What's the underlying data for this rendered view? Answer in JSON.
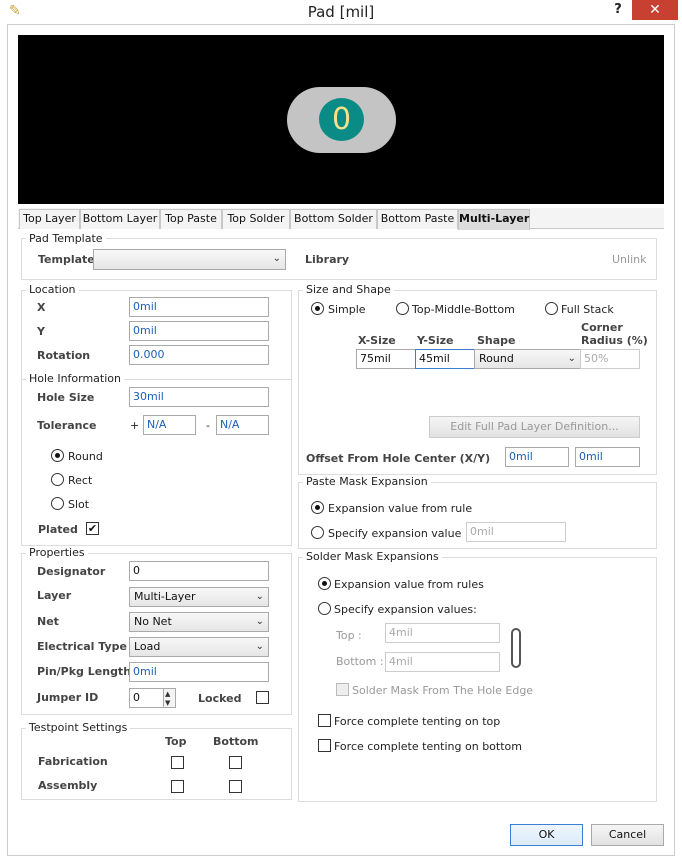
{
  "window": {
    "title": "Pad [mil]",
    "help": "?",
    "close": "✕",
    "app_icon": "pad-app-icon"
  },
  "preview": {
    "pad_number": "0",
    "pad_color": "#c4c4c4",
    "hole_color": "#0a8b86",
    "text_color": "#f3e28a"
  },
  "tabs": [
    "Top Layer",
    "Bottom Layer",
    "Top Paste",
    "Top Solder",
    "Bottom Solder",
    "Bottom Paste",
    "Multi-Layer"
  ],
  "active_tab": "Multi-Layer",
  "pad_template": {
    "title": "Pad Template",
    "template_label": "Template",
    "template_value": "",
    "library_label": "Library",
    "unlink_label": "Unlink"
  },
  "location": {
    "title": "Location",
    "x_label": "X",
    "x_value": "0mil",
    "y_label": "Y",
    "y_value": "0mil",
    "rotation_label": "Rotation",
    "rotation_value": "0.000"
  },
  "hole": {
    "title": "Hole Information",
    "hole_size_label": "Hole Size",
    "hole_size_value": "30mil",
    "tolerance_label": "Tolerance",
    "plus": "+",
    "minus": "-",
    "tol_plus": "N/A",
    "tol_minus": "N/A",
    "round": "Round",
    "rect": "Rect",
    "slot": "Slot",
    "plated_label": "Plated",
    "plated_check": "✔"
  },
  "properties": {
    "title": "Properties",
    "designator_label": "Designator",
    "designator_value": "0",
    "layer_label": "Layer",
    "layer_value": "Multi-Layer",
    "net_label": "Net",
    "net_value": "No Net",
    "etype_label": "Electrical Type",
    "etype_value": "Load",
    "pinpkg_label": "Pin/Pkg Length",
    "pinpkg_value": "0mil",
    "jumper_label": "Jumper ID",
    "jumper_value": "0",
    "locked_label": "Locked",
    "spin_up": "▲",
    "spin_down": "▼"
  },
  "testpoint": {
    "title": "Testpoint Settings",
    "top": "Top",
    "bottom": "Bottom",
    "fabrication": "Fabrication",
    "assembly": "Assembly"
  },
  "size_shape": {
    "title": "Size and Shape",
    "simple": "Simple",
    "tmb": "Top-Middle-Bottom",
    "fullstack": "Full Stack",
    "xsize_h": "X-Size",
    "ysize_h": "Y-Size",
    "shape_h": "Shape",
    "corner_h1": "Corner",
    "corner_h2": "Radius (%)",
    "xsize": "75mil",
    "ysize": "45mil",
    "shape": "Round",
    "corner": "50%",
    "edit_full": "Edit Full Pad Layer Definition...",
    "offset_label": "Offset From Hole Center (X/Y)",
    "offset_x": "0mil",
    "offset_y": "0mil"
  },
  "paste": {
    "title": "Paste Mask Expansion",
    "from_rule": "Expansion value from rule",
    "specify": "Specify expansion value",
    "value": "0mil"
  },
  "solder": {
    "title": "Solder Mask Expansions",
    "from_rules": "Expansion value from rules",
    "specify": "Specify expansion values:",
    "top_label": "Top :",
    "top_value": "4mil",
    "bottom_label": "Bottom :",
    "bottom_value": "4mil",
    "from_hole": "Solder Mask From The Hole Edge",
    "tent_top": "Force complete tenting on top",
    "tent_bottom": "Force complete tenting on bottom"
  },
  "buttons": {
    "ok": "OK",
    "cancel": "Cancel"
  },
  "dropdown_arrow": "⌄"
}
